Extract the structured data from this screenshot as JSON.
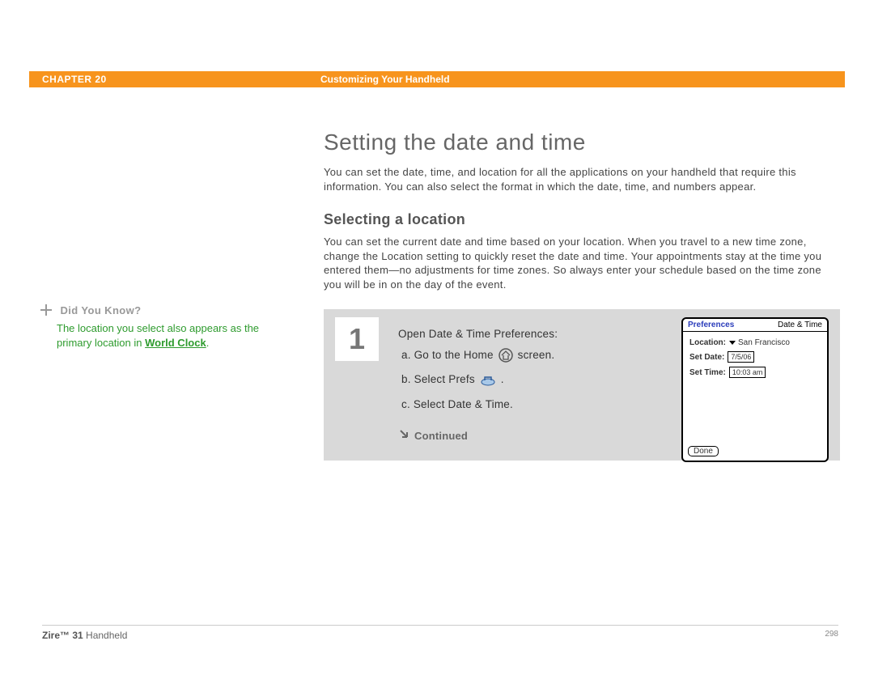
{
  "header": {
    "chapter_label": "CHAPTER 20",
    "chapter_title": "Customizing Your Handheld"
  },
  "sidebar": {
    "dyk_label": "Did You Know?",
    "dyk_prefix": "The location you select also appears as the primary location in ",
    "dyk_link": "World Clock",
    "dyk_suffix": "."
  },
  "section": {
    "title": "Setting the date and time",
    "intro": "You can set the date, time, and location for all the applications on your handheld that require this information. You can also select the format in which the date, time, and numbers appear.",
    "sub_title": "Selecting a location",
    "sub_body": "You can set the current date and time based on your location. When you travel to a new time zone, change the Location setting to quickly reset the date and time. Your appointments stay at the time you entered them—no adjustments for time zones. So always enter your schedule based on the time zone you will be in on the day of the event."
  },
  "step": {
    "number": "1",
    "line_open": "Open Date & Time Preferences:",
    "a_pre": "a.  Go to the Home ",
    "a_post": " screen.",
    "b_pre": "b.  Select Prefs ",
    "b_post": ".",
    "c": "c.  Select Date & Time.",
    "continued": "Continued"
  },
  "device": {
    "title": "Preferences",
    "subtitle": "Date & Time",
    "location_label": "Location:",
    "location_value": "San Francisco",
    "date_label": "Set Date:",
    "date_value": "7/5/06",
    "time_label": "Set Time:",
    "time_value": "10:03 am",
    "done": "Done"
  },
  "footer": {
    "product_bold": "Zire™ 31",
    "product_rest": " Handheld",
    "page": "298"
  }
}
